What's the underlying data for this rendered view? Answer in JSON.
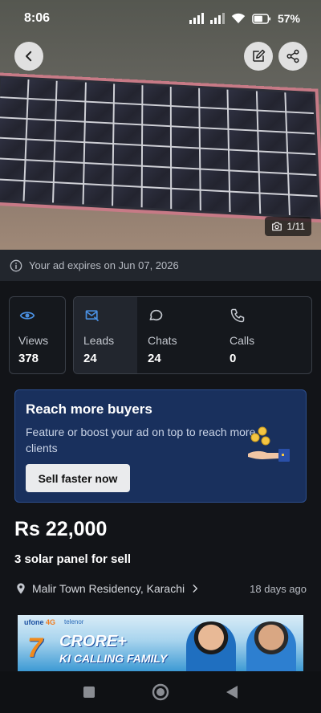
{
  "status_bar": {
    "time": "8:06",
    "battery": "57%"
  },
  "gallery": {
    "counter": "1/11"
  },
  "expiry": {
    "text": "Your ad expires on Jun 07, 2026"
  },
  "stats": [
    {
      "label": "Views",
      "value": "378",
      "icon": "eye-icon"
    },
    {
      "label": "Leads",
      "value": "24",
      "icon": "mail-phone-icon"
    },
    {
      "label": "Chats",
      "value": "24",
      "icon": "chat-bubble-icon"
    },
    {
      "label": "Calls",
      "value": "0",
      "icon": "phone-icon"
    }
  ],
  "promo": {
    "title": "Reach more buyers",
    "description": "Feature or boost your ad on top to reach more clients",
    "button": "Sell faster now"
  },
  "listing": {
    "price": "Rs 22,000",
    "title": "3 solar panel for sell",
    "location": "Malir Town Residency, Karachi",
    "posted": "18 days ago"
  },
  "ad_banner": {
    "brand": "ufone",
    "brand_suffix": "4G",
    "partner": "telenor",
    "big_number": "7",
    "headline": "CRORE+",
    "tagline": "KI CALLING FAMILY"
  },
  "colors": {
    "accent": "#2d4f8e",
    "promo_bg": "#19305d",
    "background": "#121418"
  }
}
